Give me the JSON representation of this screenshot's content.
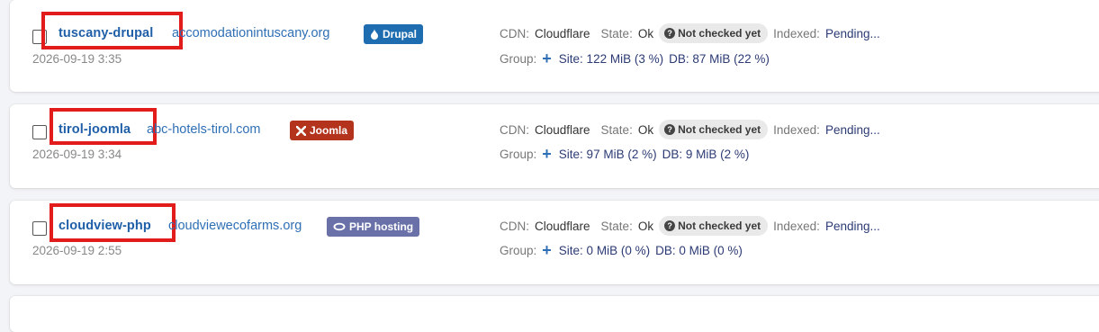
{
  "sites": [
    {
      "name": "tuscany-drupal",
      "domain": "accomodationintuscany.org",
      "platform": "Drupal",
      "platform_color": "#1f6db1",
      "platform_icon": "drop-icon",
      "date": "2026-09-19 3:35",
      "cdn_label": "CDN:",
      "cdn": "Cloudflare",
      "state_label": "State:",
      "state": "Ok",
      "check_status": "Not checked yet",
      "indexed_label": "Indexed:",
      "indexed": "Pending...",
      "group_label": "Group:",
      "group_add": "+",
      "site_usage": "Site: 122 MiB (3 %)",
      "db_usage": "DB: 87 MiB (22 %)",
      "highlighted": true
    },
    {
      "name": "tirol-joomla",
      "domain": "abc-hotels-tirol.com",
      "platform": "Joomla",
      "platform_color": "#b3331c",
      "platform_icon": "joomla-icon",
      "date": "2026-09-19 3:34",
      "cdn_label": "CDN:",
      "cdn": "Cloudflare",
      "state_label": "State:",
      "state": "Ok",
      "check_status": "Not checked yet",
      "indexed_label": "Indexed:",
      "indexed": "Pending...",
      "group_label": "Group:",
      "group_add": "+",
      "site_usage": "Site: 97 MiB (2 %)",
      "db_usage": "DB: 9 MiB (2 %)",
      "highlighted": true
    },
    {
      "name": "cloudview-php",
      "domain": "cloudviewecofarms.org",
      "platform": "PHP hosting",
      "platform_color": "#6a71a8",
      "platform_icon": "php-icon",
      "date": "2026-09-19 2:55",
      "cdn_label": "CDN:",
      "cdn": "Cloudflare",
      "state_label": "State:",
      "state": "Ok",
      "check_status": "Not checked yet",
      "indexed_label": "Indexed:",
      "indexed": "Pending...",
      "group_label": "Group:",
      "group_add": "+",
      "site_usage": "Site: 0 MiB (0 %)",
      "db_usage": "DB: 0 MiB (0 %)",
      "highlighted": true
    }
  ],
  "colors": {
    "highlight_border": "#e21b1b",
    "link": "#2f6fb5",
    "site_name": "#1f5fa8"
  }
}
